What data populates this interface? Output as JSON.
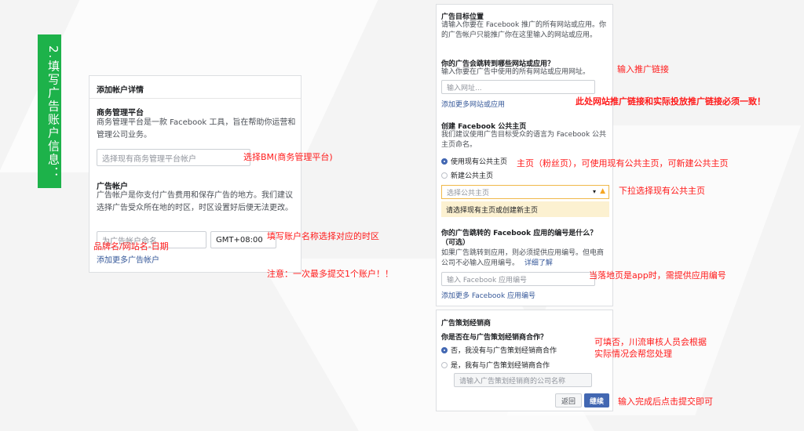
{
  "step_tag": "2.填写广告账户信息：",
  "left_panel": {
    "title": "添加帐户详情",
    "bm_label": "商务管理平台",
    "bm_desc": "商务管理平台是一款 Facebook 工具，旨在帮助你运营和管理公司业务。",
    "bm_placeholder": "选择现有商务管理平台帐户",
    "ad_label": "广告帐户",
    "ad_desc": "广告帐户是你支付广告费用和保存广告的地方。我们建议选择广告受众所在地的时区，时区设置好后便无法更改。",
    "name_placeholder": "为广告帐户命名",
    "timezone_value": "GMT+08:00",
    "add_more_link": "添加更多广告帐户"
  },
  "right_panel": {
    "target_title": "广告目标位置",
    "target_desc": "请输入你要在 Facebook 推广的所有网站或应用。你的广告帐户只能推广你在这里输入的网站或应用。",
    "site_label": "你的广告会跳转到哪些网站或应用？",
    "site_desc": "输入你要在广告中使用的所有网站或应用网址。",
    "url_placeholder": "输入网址...",
    "add_site_link": "添加更多网站或应用",
    "page_label": "创建 Facebook 公共主页",
    "page_desc": "我们建议使用广告目标受众的语言为 Facebook 公共主页命名。",
    "radio_use_existing": "使用现有公共主页",
    "radio_create_new": "新建公共主页",
    "page_select_placeholder": "选择公共主页",
    "page_warning": "请选择现有主页或创建新主页",
    "app_label": "你的广告跳转的 Facebook 应用的编号是什么？（可选）",
    "app_desc": "如果广告跳转到应用，则必须提供应用编号。但电商公司不必输入应用编号。",
    "app_learn_more": "详细了解",
    "app_placeholder": "输入 Facebook 应用编号",
    "add_app_link": "添加更多 Facebook 应用编号"
  },
  "agency_panel": {
    "title": "广告策划经销商",
    "question": "你是否在与广告策划经销商合作？",
    "radio_no": "否，我没有与广告策划经销商合作",
    "radio_yes": "是，我有与广告策划经销商合作",
    "agency_placeholder": "请输入广告策划经销商的公司名称",
    "back_button": "返回",
    "continue_button": "继续"
  },
  "annotations": {
    "bm": "选择BM(商务管理平台)",
    "account_name": "填写账户名称选择对应的时区",
    "name_format": "品牌名/网站名-日期",
    "limit": "注意：一次最多提交1个账户！！",
    "url": "输入推广链接",
    "url_match": "此处网站推广链接和实际投放推广链接必须一致！",
    "homepage": "主页（粉丝页），可使用现有公共主页，可新建公共主页",
    "dropdown": "下拉选择现有公共主页",
    "app_id": "当落地页是app时，需提供应用编号",
    "agency_1": "可填否，川流审核人员会根据",
    "agency_2": "实际情况会帮您处理",
    "submit": "输入完成后点击提交即可"
  },
  "colors": {
    "green": "#1db24a",
    "red": "#ff1a1a",
    "link": "#365899",
    "button_blue": "#4267b2",
    "warning_bg": "#fcf1d1"
  }
}
